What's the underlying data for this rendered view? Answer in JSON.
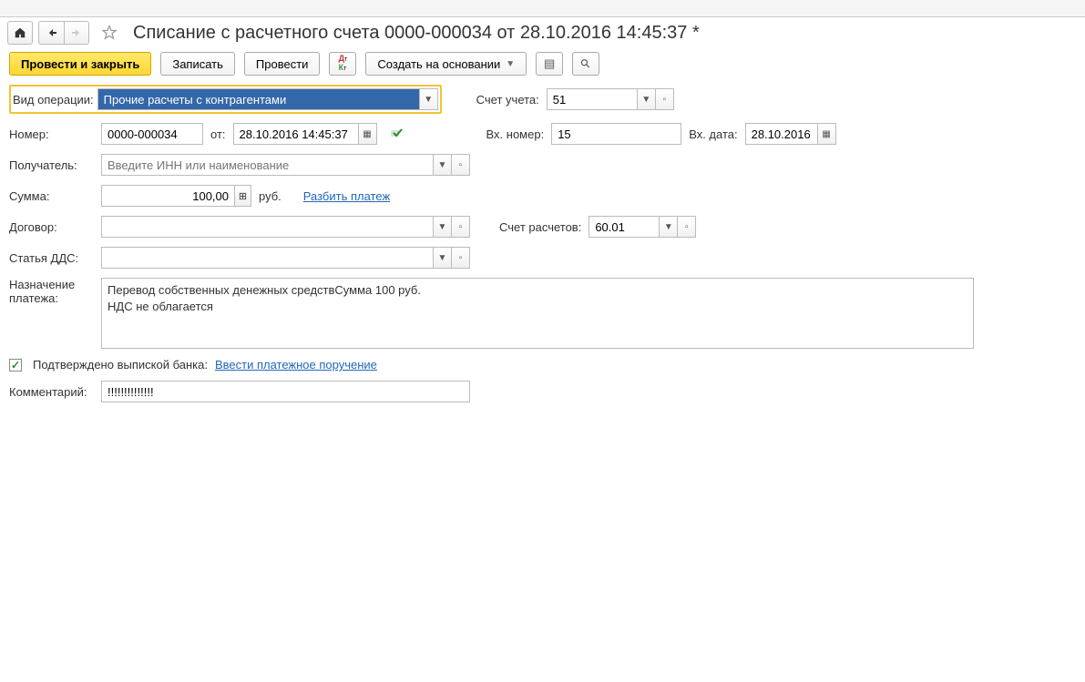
{
  "header": {
    "title": "Списание с расчетного счета 0000-000034 от 28.10.2016 14:45:37 *"
  },
  "toolbar": {
    "post_close": "Провести и закрыть",
    "write": "Записать",
    "post": "Провести",
    "create_based": "Создать на основании"
  },
  "labels": {
    "operation_type": "Вид операции:",
    "account": "Счет учета:",
    "number": "Номер:",
    "from": "от:",
    "in_number": "Вх. номер:",
    "in_date": "Вх. дата:",
    "recipient": "Получатель:",
    "amount": "Сумма:",
    "currency": "руб.",
    "split_payment": "Разбить платеж",
    "contract": "Договор:",
    "settlement_account": "Счет расчетов:",
    "dds": "Статья ДДС:",
    "purpose": "Назначение\nплатежа:",
    "confirmed": "Подтверждено выпиской банка:",
    "enter_payment": "Ввести платежное поручение",
    "comment": "Комментарий:"
  },
  "values": {
    "operation_type": "Прочие расчеты с контрагентами",
    "account": "51",
    "number": "0000-000034",
    "date": "28.10.2016 14:45:37",
    "in_number": "15",
    "in_date": "28.10.2016",
    "recipient_placeholder": "Введите ИНН или наименование",
    "amount": "100,00",
    "contract": "",
    "settlement_account": "60.01",
    "dds": "",
    "purpose": "Перевод собственных денежных средствСумма 100 руб.\nНДС не облагается",
    "confirmed": true,
    "comment": "!!!!!!!!!!!!!!"
  }
}
